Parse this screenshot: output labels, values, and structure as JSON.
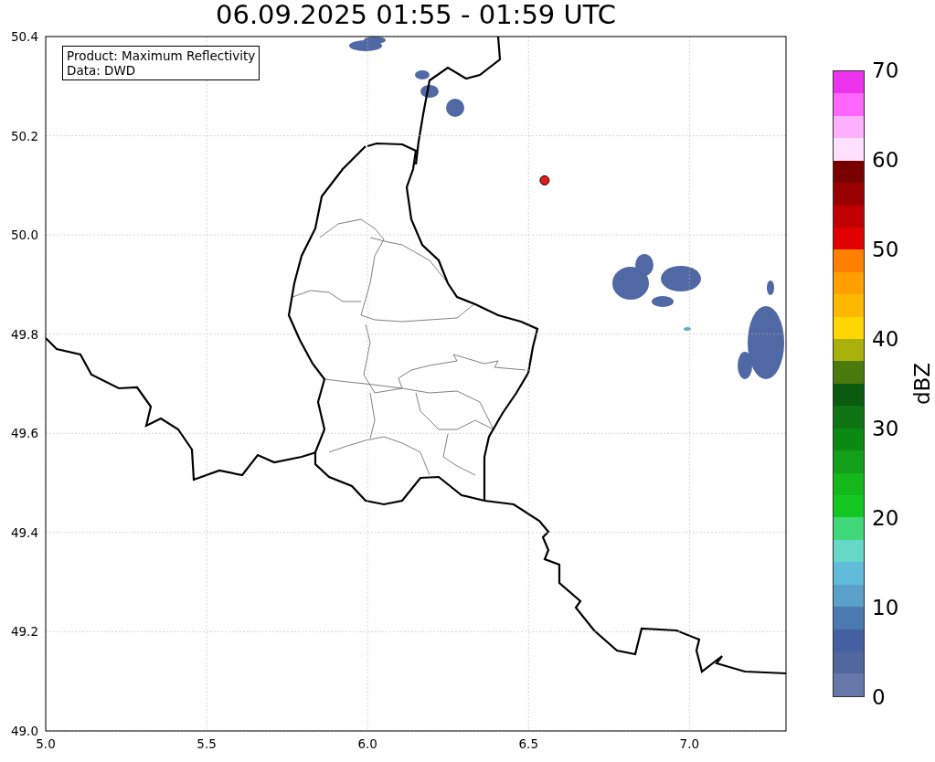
{
  "title": "06.09.2025 01:55 - 01:59 UTC",
  "map": {
    "legend": [
      "Product: Maximum Reflectivity",
      "Data: DWD"
    ],
    "chart_data": {
      "type": "scatter",
      "grid": true,
      "xlim": [
        5.0,
        7.3
      ],
      "ylim": [
        49.0,
        50.4
      ],
      "xticks": [
        {
          "value": 5.0,
          "label": "5.0"
        },
        {
          "value": 5.5,
          "label": "5.5"
        },
        {
          "value": 6.0,
          "label": "6.0"
        },
        {
          "value": 6.5,
          "label": "6.5"
        },
        {
          "value": 7.0,
          "label": "7.0"
        }
      ],
      "yticks": [
        {
          "value": 49.0,
          "label": "49.0"
        },
        {
          "value": 49.2,
          "label": "49.2"
        },
        {
          "value": 49.4,
          "label": "49.4"
        },
        {
          "value": 49.6,
          "label": "49.6"
        },
        {
          "value": 49.8,
          "label": "49.8"
        },
        {
          "value": 50.0,
          "label": "50.0"
        },
        {
          "value": 50.2,
          "label": "50.2"
        },
        {
          "value": 50.4,
          "label": "50.4"
        }
      ],
      "x": [
        6.55
      ],
      "series": [
        {
          "color": "#e41a1c",
          "values": [
            50.11
          ]
        }
      ]
    }
  },
  "colorbar": {
    "label": "dBZ",
    "ticks": [
      "70",
      "60",
      "50",
      "40",
      "30",
      "20",
      "10",
      "0"
    ],
    "segments": [
      {
        "color": "#ee33ee"
      },
      {
        "color": "#ff66ff"
      },
      {
        "color": "#ffb0ff"
      },
      {
        "color": "#ffe0ff"
      },
      {
        "color": "#780000"
      },
      {
        "color": "#9a0000"
      },
      {
        "color": "#c00000"
      },
      {
        "color": "#e00000"
      },
      {
        "color": "#ff8000"
      },
      {
        "color": "#ffa000"
      },
      {
        "color": "#ffb800"
      },
      {
        "color": "#ffd700"
      },
      {
        "color": "#aab00a"
      },
      {
        "color": "#4a7a0c"
      },
      {
        "color": "#0a5a10"
      },
      {
        "color": "#0e7414"
      },
      {
        "color": "#0a8a12"
      },
      {
        "color": "#12a01a"
      },
      {
        "color": "#14b81a"
      },
      {
        "color": "#12c820"
      },
      {
        "color": "#40d878"
      },
      {
        "color": "#66d8c8"
      },
      {
        "color": "#60bcd8"
      },
      {
        "color": "#5aa0c8"
      },
      {
        "color": "#4a7ab0"
      },
      {
        "color": "#4460a0"
      },
      {
        "color": "#52669e"
      },
      {
        "color": "#6678a8"
      }
    ]
  }
}
